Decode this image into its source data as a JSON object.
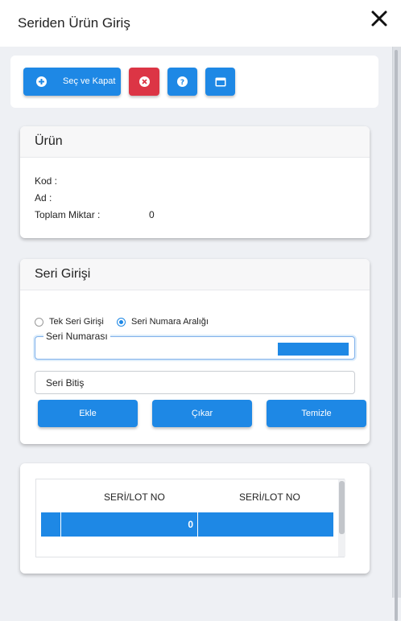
{
  "dialog": {
    "title": "Seriden Ürün Giriş",
    "close_icon": "close-icon"
  },
  "toolbar": {
    "select_close_label": "Seç ve Kapat"
  },
  "product_card": {
    "title": "Ürün",
    "code_label": "Kod :",
    "name_label": "Ad :",
    "total_label": "Toplam Miktar :",
    "total_value": "0"
  },
  "serial_card": {
    "title": "Seri Girişi",
    "radio_single": "Tek Seri Girişi",
    "radio_range": "Seri Numara Aralığı",
    "selected_mode": "range",
    "serial_no_label": "Seri Numarası",
    "serial_end_placeholder": "Seri Bitiş",
    "add_label": "Ekle",
    "remove_label": "Çıkar",
    "clear_label": "Temizle"
  },
  "grid": {
    "columns": [
      "SERİ/LOT NO",
      "SERİ/LOT NO"
    ],
    "rows": [
      {
        "value": "0"
      }
    ]
  },
  "colors": {
    "primary": "#1e88e5",
    "danger": "#dc3545"
  }
}
